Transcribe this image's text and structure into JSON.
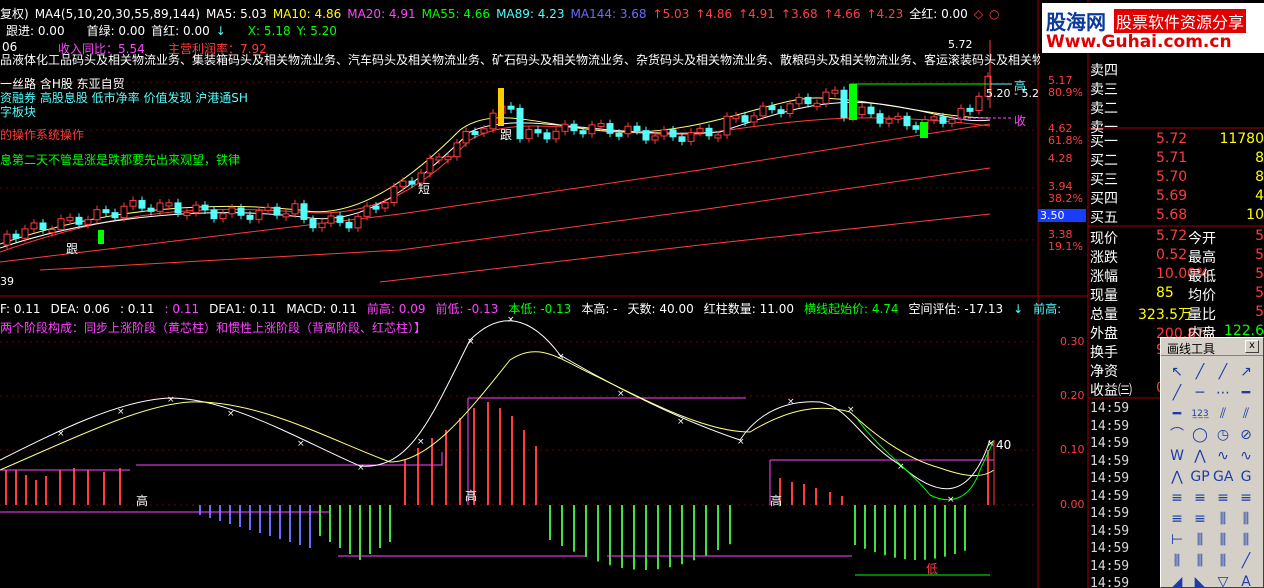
{
  "header": {
    "mode": "复权)",
    "ma_params": "MA4(5,10,20,30,55,89,144)",
    "ma5": "MA5: 5.03",
    "ma10": "MA10: 4.86",
    "ma20": "MA20: 4.91",
    "ma55": "MA55: 4.66",
    "ma89": "MA89: 4.23",
    "ma144": "MA144: 3.68",
    "v1": "5.03",
    "v2": "4.86",
    "v3": "4.91",
    "v4": "3.68",
    "v5": "4.66",
    "v6": "4.23",
    "quanhong": "全红: 0.00",
    "genjin": "跟进: 0.00",
    "shoulv": "首绿: 0.00",
    "shouhong": "首红: 0.00",
    "x_label": "X: 5.18",
    "y_label": "Y: 5.20",
    "top_left_num": "06",
    "revenue_label": "收入同比：5.54",
    "profit_label": "主营利润率：7.92"
  },
  "overlay_text": {
    "industry": "品液体化工品码头及相关物流业务、集装箱码头及相关物流业务、汽车码头及相关物流业务、矿石码头及相关物流业务、杂货码头及相关物流业务、散粮码头及相关物流业务、客运滚装码头及相关物",
    "tags1": "一丝路 含H股 东亚自贸",
    "tags2": "资融券 高股息股 低市净率 价值发现 沪港通SH",
    "tags3": "字板块",
    "tip1": "的操作系统操作",
    "tip2": "息第二天不管是涨是跌都要先出来观望，铁律",
    "mark_gen1": "跟",
    "mark_duan": "短",
    "mark_gen2": "跟",
    "mark_high": "高",
    "mark_collect": "收",
    "price_high_label": "5.72",
    "price_now_labels": "5.20 - 5.2",
    "bottom_num": "39"
  },
  "price_axis": {
    "labels": [
      "5.17",
      "80.9%",
      "4.62",
      "61.8%",
      "4.28",
      "3.94",
      "38.2%",
      "3.50",
      "3.38",
      "19.1%"
    ]
  },
  "indicator_header": {
    "a": "F: 0.11",
    "dea": "DEA: 0.06",
    "b": ": 0.11",
    "c": ": 0.11",
    "dea1": "DEA1: 0.11",
    "macd": "MACD: 0.11",
    "qiangao": "前高: 0.09",
    "qiandi": "前低: -0.13",
    "bendi": "本低: -0.13",
    "bengao": "本高: -",
    "tianshu": "天数: 40.00",
    "hongzhu": "红柱数量: 11.00",
    "hengxian": "横线起始价: 4.74",
    "kongjian": "空间评估: -17.13",
    "qiangao2": "前高:",
    "desc": "两个阶段构成：同步上涨阶段（黄芯柱）和惯性上涨阶段（背离阶段、红芯柱）】"
  },
  "indicator_axis": {
    "labels": [
      "0.30",
      "0.20",
      "0.10",
      "0.00"
    ],
    "gao_labels": [
      "高",
      "高",
      "高"
    ],
    "end_label": "40",
    "di_label": "低"
  },
  "orderbook": {
    "sells_top": [
      "卖四",
      "卖三",
      "卖二",
      "卖一"
    ],
    "buys": [
      {
        "label": "买一",
        "price": "5.72",
        "vol": "11780"
      },
      {
        "label": "买二",
        "price": "5.71",
        "vol": "8"
      },
      {
        "label": "买三",
        "price": "5.70",
        "vol": "8"
      },
      {
        "label": "买四",
        "price": "5.69",
        "vol": "4"
      },
      {
        "label": "买五",
        "price": "5.68",
        "vol": "10"
      }
    ],
    "stats": [
      {
        "k1": "现价",
        "v1": "5.72",
        "k2": "今开",
        "v2": "5"
      },
      {
        "k1": "涨跌",
        "v1": "0.52",
        "k2": "最高",
        "v2": "5"
      },
      {
        "k1": "涨幅",
        "v1": "10.00%",
        "k2": "最低",
        "v2": "5"
      },
      {
        "k1": "现量",
        "v1": "85",
        "k2": "均价",
        "v2": "5"
      },
      {
        "k1": "总量",
        "v1": "323.5万",
        "k2": "量比",
        "v2": "5"
      },
      {
        "k1": "外盘",
        "v1": "200.8万",
        "k2": "内盘",
        "v2": "122.6"
      },
      {
        "k1": "换手",
        "v1": "9.",
        "k2": "",
        "v2": ""
      },
      {
        "k1": "净资",
        "v1": "",
        "k2": "",
        "v2": ""
      },
      {
        "k1": "收益㈢",
        "v1": "0",
        "k2": "",
        "v2": ""
      }
    ],
    "times": [
      "14:59",
      "14:59",
      "14:59",
      "14:59",
      "14:59",
      "14:59",
      "14:59",
      "14:59",
      "14:59",
      "14:59",
      "14:59"
    ]
  },
  "drawing_tool": {
    "title": "画线工具",
    "close": "x",
    "tools": [
      "↖",
      "╱",
      "╱",
      "↗",
      "╱",
      "─",
      "⋯",
      "━",
      "━",
      "1̲2̲3̲",
      "⫽",
      "⫽",
      "⌒",
      "◯",
      "◷",
      "⊘",
      "W",
      "⋀",
      "∿",
      "∿",
      "⋀",
      "GP",
      "GA",
      "G",
      "≡",
      "≡",
      "≡",
      "≡",
      "≡",
      "≡",
      "⫼",
      "⫼",
      "⊢",
      "⫼",
      "⫼",
      "⫼",
      "⫼",
      "⫼",
      "⫼",
      "╱",
      "◢",
      "◣",
      "▽",
      "A"
    ]
  },
  "logo": {
    "brand": "股海网",
    "slogan": "股票软件资源分享",
    "url": "Www.Guhai.com.cn"
  },
  "colors": {
    "up": "#ff3c3c",
    "down": "#54fcfc",
    "yellow": "#ffff00",
    "magenta": "#ff44ff",
    "green": "#00ff00",
    "blue": "#6a6aff"
  }
}
